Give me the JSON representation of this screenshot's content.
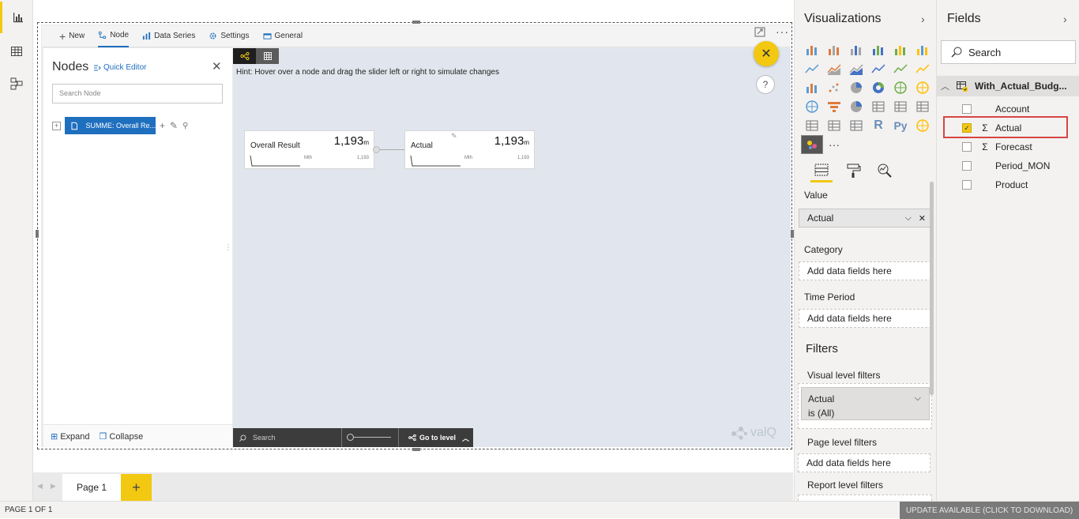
{
  "canvas": {
    "menu": [
      {
        "icon": "plus-icon",
        "label": "New"
      },
      {
        "icon": "node-icon",
        "label": "Node",
        "active": true
      },
      {
        "icon": "data-series-icon",
        "label": "Data Series"
      },
      {
        "icon": "gear-icon",
        "label": "Settings"
      },
      {
        "icon": "general-icon",
        "label": "General"
      }
    ],
    "nodes_panel": {
      "title": "Nodes",
      "quick_editor": "Quick Editor",
      "search_placeholder": "Search Node",
      "tree_node": "SUMME: Overall Re...",
      "expand": "Expand",
      "collapse": "Collapse"
    },
    "hint": "Hint: Hover over a node and drag the slider left or right to simulate changes",
    "nodes": [
      {
        "name": "Overall Result",
        "value": "1,193",
        "unit": "m",
        "period": "Mth",
        "small_value": "1,193"
      },
      {
        "name": "Actual",
        "value": "1,193",
        "unit": "m",
        "period": "Mth",
        "small_value": "1,193"
      }
    ],
    "toolbar": {
      "search": "Search",
      "goto": "Go to level"
    },
    "logo": "valQ"
  },
  "pages": {
    "tab": "Page 1",
    "add": "+"
  },
  "status": {
    "left": "PAGE 1 OF 1",
    "update": "UPDATE AVAILABLE (CLICK TO DOWNLOAD)"
  },
  "visualizations": {
    "title": "Visualizations",
    "icons": [
      "stacked-bar-icon",
      "stacked-column-icon",
      "clustered-bar-icon",
      "clustered-column-icon",
      "100-bar-icon",
      "100-column-icon",
      "line-chart-icon",
      "area-chart-icon",
      "stacked-area-icon",
      "line-column-icon",
      "line-clustered-icon",
      "ribbon-icon",
      "waterfall-icon",
      "scatter-icon",
      "pie-icon",
      "donut-icon",
      "treemap-icon",
      "map-icon",
      "filled-map-icon",
      "funnel-icon",
      "gauge-icon",
      "card-icon",
      "multi-row-card-icon",
      "kpi-icon",
      "slicer-icon",
      "table-icon",
      "matrix-icon",
      "r-visual-icon",
      "python-visual-icon",
      "arcgis-icon",
      "custom-visual-icon",
      "more-icon"
    ],
    "wells": {
      "value_label": "Value",
      "value_field": "Actual",
      "category_label": "Category",
      "category_placeholder": "Add data fields here",
      "time_label": "Time Period",
      "time_placeholder": "Add data fields here"
    },
    "filters": {
      "title": "Filters",
      "visual_level": "Visual level filters",
      "card_field": "Actual",
      "card_value": "is (All)",
      "page_level": "Page level filters",
      "page_placeholder": "Add data fields here",
      "report_level": "Report level filters"
    }
  },
  "fields": {
    "title": "Fields",
    "search_placeholder": "Search",
    "table": "With_Actual_Budg...",
    "items": [
      {
        "name": "Account",
        "checked": false,
        "sigma": false
      },
      {
        "name": "Actual",
        "checked": true,
        "sigma": true
      },
      {
        "name": "Forecast",
        "checked": false,
        "sigma": true
      },
      {
        "name": "Period_MON",
        "checked": false,
        "sigma": false
      },
      {
        "name": "Product",
        "checked": false,
        "sigma": false
      }
    ]
  },
  "colors": {
    "accent": "#f2c811",
    "valq_blue": "#1f6fbf",
    "highlight": "#d64545"
  }
}
